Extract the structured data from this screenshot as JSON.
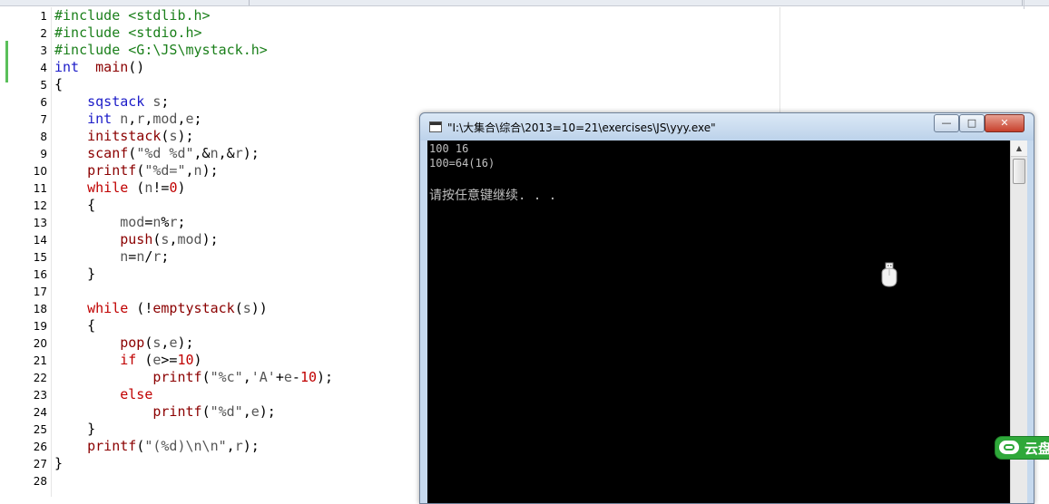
{
  "editor": {
    "line_numbers": [
      "1",
      "2",
      "3",
      "4",
      "5",
      "6",
      "7",
      "8",
      "9",
      "10",
      "11",
      "12",
      "13",
      "14",
      "15",
      "16",
      "17",
      "18",
      "19",
      "20",
      "21",
      "22",
      "23",
      "24",
      "25",
      "26",
      "27",
      "28"
    ],
    "lines": [
      [
        [
          "pp",
          "#include <stdlib.h>"
        ]
      ],
      [
        [
          "pp",
          "#include <stdio.h>"
        ]
      ],
      [
        [
          "pp",
          "#include <G:\\JS\\mystack.h>"
        ]
      ],
      [
        [
          "ty",
          "int"
        ],
        [
          "",
          "  "
        ],
        [
          "fn",
          "main"
        ],
        [
          "",
          "()"
        ]
      ],
      [
        [
          "",
          "{"
        ]
      ],
      [
        [
          "",
          "    "
        ],
        [
          "ty",
          "sqstack"
        ],
        [
          "",
          " "
        ],
        [
          "vr",
          "s"
        ],
        [
          "",
          ";"
        ]
      ],
      [
        [
          "",
          "    "
        ],
        [
          "ty",
          "int"
        ],
        [
          "",
          " "
        ],
        [
          "vr",
          "n"
        ],
        [
          "",
          ","
        ],
        [
          "vr",
          "r"
        ],
        [
          "",
          ","
        ],
        [
          "vr",
          "mod"
        ],
        [
          "",
          ","
        ],
        [
          "vr",
          "e"
        ],
        [
          "",
          ";"
        ]
      ],
      [
        [
          "",
          "    "
        ],
        [
          "fn",
          "initstack"
        ],
        [
          "",
          "("
        ],
        [
          "vr",
          "s"
        ],
        [
          "",
          ");"
        ]
      ],
      [
        [
          "",
          "    "
        ],
        [
          "fn",
          "scanf"
        ],
        [
          "",
          "("
        ],
        [
          "st",
          "\"%d %d\""
        ],
        [
          "",
          ",&"
        ],
        [
          "vr",
          "n"
        ],
        [
          "",
          ",&"
        ],
        [
          "vr",
          "r"
        ],
        [
          "",
          ");"
        ]
      ],
      [
        [
          "",
          "    "
        ],
        [
          "fn",
          "printf"
        ],
        [
          "",
          "("
        ],
        [
          "st",
          "\"%d=\""
        ],
        [
          "",
          ","
        ],
        [
          "vr",
          "n"
        ],
        [
          "",
          ");"
        ]
      ],
      [
        [
          "",
          "    "
        ],
        [
          "kw",
          "while"
        ],
        [
          "",
          " ("
        ],
        [
          "vr",
          "n"
        ],
        [
          "",
          "!="
        ],
        [
          "nm",
          "0"
        ],
        [
          "",
          ")"
        ]
      ],
      [
        [
          "",
          "    {"
        ]
      ],
      [
        [
          "",
          "        "
        ],
        [
          "vr",
          "mod"
        ],
        [
          "",
          "="
        ],
        [
          "vr",
          "n"
        ],
        [
          "",
          "%"
        ],
        [
          "vr",
          "r"
        ],
        [
          "",
          ";"
        ]
      ],
      [
        [
          "",
          "        "
        ],
        [
          "fn",
          "push"
        ],
        [
          "",
          "("
        ],
        [
          "vr",
          "s"
        ],
        [
          "",
          ","
        ],
        [
          "vr",
          "mod"
        ],
        [
          "",
          ");"
        ]
      ],
      [
        [
          "",
          "        "
        ],
        [
          "vr",
          "n"
        ],
        [
          "",
          "="
        ],
        [
          "vr",
          "n"
        ],
        [
          "",
          "/"
        ],
        [
          "vr",
          "r"
        ],
        [
          "",
          ";"
        ]
      ],
      [
        [
          "",
          "    }"
        ]
      ],
      [
        [
          "",
          ""
        ]
      ],
      [
        [
          "",
          "    "
        ],
        [
          "kw",
          "while"
        ],
        [
          "",
          " (!"
        ],
        [
          "fn",
          "emptystack"
        ],
        [
          "",
          "("
        ],
        [
          "vr",
          "s"
        ],
        [
          "",
          "))"
        ]
      ],
      [
        [
          "",
          "    {"
        ]
      ],
      [
        [
          "",
          "        "
        ],
        [
          "fn",
          "pop"
        ],
        [
          "",
          "("
        ],
        [
          "vr",
          "s"
        ],
        [
          "",
          ","
        ],
        [
          "vr",
          "e"
        ],
        [
          "",
          ");"
        ]
      ],
      [
        [
          "",
          "        "
        ],
        [
          "kw",
          "if"
        ],
        [
          "",
          " ("
        ],
        [
          "vr",
          "e"
        ],
        [
          "",
          ">="
        ],
        [
          "nm",
          "10"
        ],
        [
          "",
          ")"
        ]
      ],
      [
        [
          "",
          "            "
        ],
        [
          "fn",
          "printf"
        ],
        [
          "",
          "("
        ],
        [
          "st",
          "\"%c\""
        ],
        [
          "",
          ","
        ],
        [
          "st",
          "'A'"
        ],
        [
          "",
          "+"
        ],
        [
          "vr",
          "e"
        ],
        [
          "",
          "-"
        ],
        [
          "nm",
          "10"
        ],
        [
          "",
          ");"
        ]
      ],
      [
        [
          "",
          "        "
        ],
        [
          "kw",
          "else"
        ]
      ],
      [
        [
          "",
          "            "
        ],
        [
          "fn",
          "printf"
        ],
        [
          "",
          "("
        ],
        [
          "st",
          "\"%d\""
        ],
        [
          "",
          ","
        ],
        [
          "vr",
          "e"
        ],
        [
          "",
          ");"
        ]
      ],
      [
        [
          "",
          "    }"
        ]
      ],
      [
        [
          "",
          "    "
        ],
        [
          "fn",
          "printf"
        ],
        [
          "",
          "("
        ],
        [
          "st",
          "\"(%d)\\n\\n\""
        ],
        [
          "",
          ","
        ],
        [
          "vr",
          "r"
        ],
        [
          "",
          ");"
        ]
      ],
      [
        [
          "",
          "}"
        ]
      ],
      [
        [
          "",
          ""
        ]
      ]
    ]
  },
  "console": {
    "title": "\"I:\\大集合\\综合\\2013=10=21\\exercises\\JS\\yyy.exe\"",
    "minimize_label": "—",
    "maximize_label": "□",
    "close_label": "✕",
    "scroll_up_label": "▲",
    "output_lines": [
      "100 16",
      "100=64(16)",
      "",
      "请按任意键继续. . ."
    ]
  },
  "cursor_icon": "usb-mouse-cursor-icon",
  "side_widget": {
    "label": "云盘",
    "icon": "cloud-icon"
  }
}
